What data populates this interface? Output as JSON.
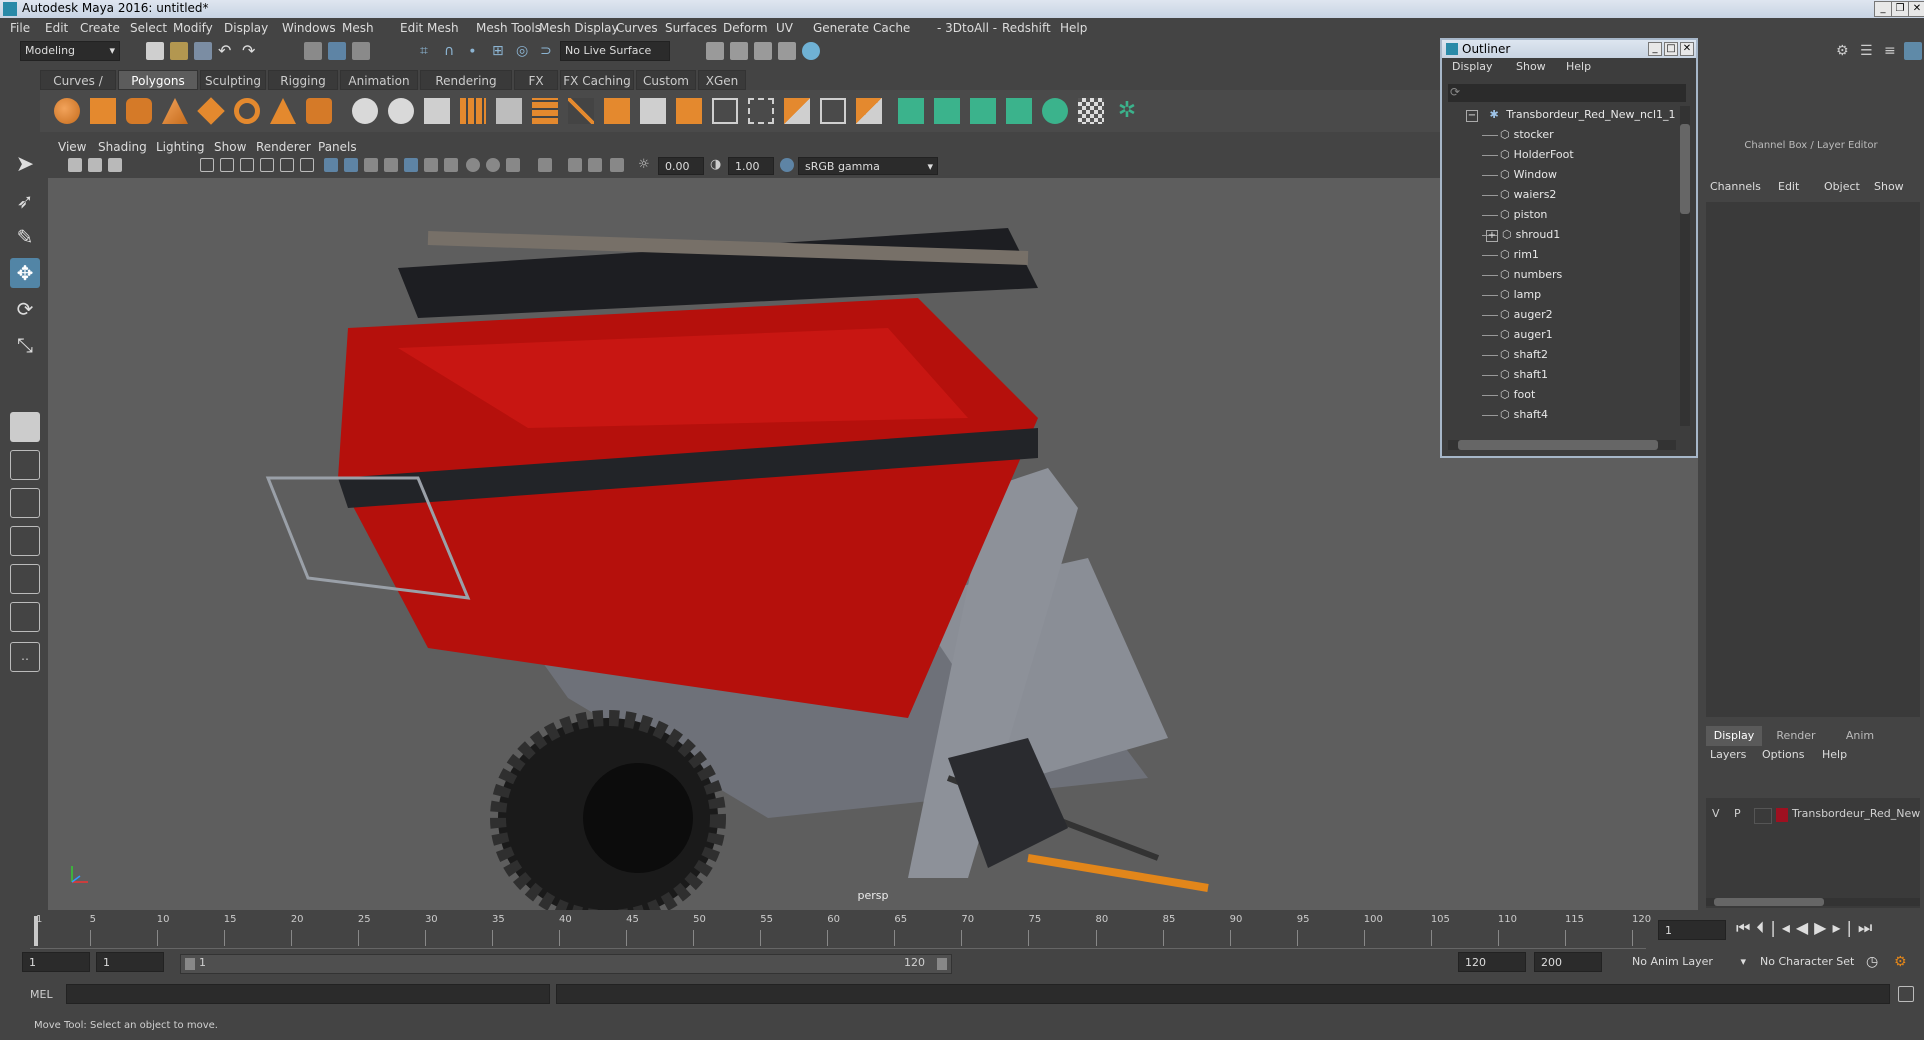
{
  "window": {
    "title": "Autodesk Maya 2016: untitled*"
  },
  "menubar": [
    "File",
    "Edit",
    "Create",
    "Select",
    "Modify",
    "Display",
    "Windows",
    "Mesh",
    "Edit Mesh",
    "Mesh Tools",
    "Mesh Display",
    "Curves",
    "Surfaces",
    "Deform",
    "UV",
    "Generate",
    "Cache",
    "- 3DtoAll -",
    "Redshift",
    "Help"
  ],
  "statusline": {
    "mode": "Modeling",
    "live_surface": "No Live Surface"
  },
  "shelf": {
    "tabs": [
      "Curves / Surfaces",
      "Polygons",
      "Sculpting",
      "Rigging",
      "Animation",
      "Rendering",
      "FX",
      "FX Caching",
      "Custom",
      "XGen"
    ],
    "active": "Polygons"
  },
  "panel": {
    "menu": [
      "View",
      "Shading",
      "Lighting",
      "Show",
      "Renderer",
      "Panels"
    ],
    "exposure": "0.00",
    "gamma": "1.00",
    "colorspace": "sRGB gamma",
    "camera_label": "persp"
  },
  "outliner": {
    "title": "Outliner",
    "menu": [
      "Display",
      "Show",
      "Help"
    ],
    "root": "Transbordeur_Red_New_ncl1_1",
    "items": [
      "stocker",
      "HolderFoot",
      "Window",
      "waiers2",
      "piston",
      "shroud1",
      "rim1",
      "numbers",
      "lamp",
      "auger2",
      "auger1",
      "shaft2",
      "shaft1",
      "foot",
      "shaft4"
    ]
  },
  "channelbox": {
    "title": "Channel Box / Layer Editor",
    "menu": [
      "Channels",
      "Edit",
      "Object",
      "Show"
    ],
    "layer_tabs": [
      "Display",
      "Render",
      "Anim"
    ],
    "layer_menu": [
      "Layers",
      "Options",
      "Help"
    ],
    "layer": {
      "v": "V",
      "p": "P",
      "name": "Transbordeur_Red_New",
      "color": "#9e1020"
    }
  },
  "timeline": {
    "ticks": [
      "1",
      "5",
      "10",
      "15",
      "20",
      "25",
      "30",
      "35",
      "40",
      "45",
      "50",
      "55",
      "60",
      "65",
      "70",
      "75",
      "80",
      "85",
      "90",
      "95",
      "100",
      "105",
      "110",
      "115",
      "120"
    ],
    "current_frame": "1"
  },
  "range": {
    "start": "1",
    "playback_start": "1",
    "slider_start": "1",
    "slider_end": "120",
    "playback_end": "120",
    "end": "200",
    "anim_layer": "No Anim Layer",
    "character_set": "No Character Set"
  },
  "cmdline": {
    "label": "MEL"
  },
  "helpline": {
    "text": "Move Tool: Select an object to move."
  },
  "colors": {
    "accent": "#5285a6",
    "model_red": "#b5100c",
    "bg_viewport": "#5e5e5e"
  }
}
